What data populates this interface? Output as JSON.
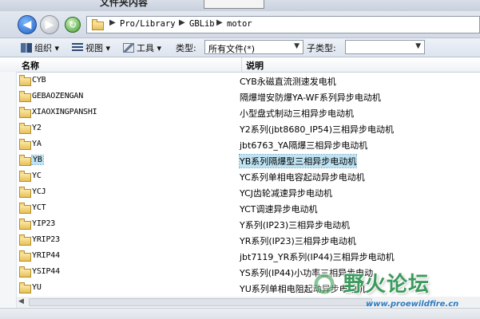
{
  "window": {
    "title": "文件夹内容"
  },
  "nav": {
    "back": "◀",
    "forward": "▶",
    "refresh": "↻",
    "path": [
      "Pro/Library",
      "GBLib",
      "motor"
    ],
    "sep": "▶"
  },
  "toolbar": {
    "organize": "组织 ▾",
    "view": "视图 ▾",
    "tools": "工具 ▾",
    "type_label": "类型:",
    "type_value": "所有文件(*)",
    "subtype_label": "子类型:",
    "subtype_value": ""
  },
  "columns": {
    "name": "名称",
    "desc": "说明"
  },
  "files": [
    {
      "name": "CYB",
      "desc": "CYB永磁直流测速发电机"
    },
    {
      "name": "GEBAOZENGAN",
      "desc": "隔爆增安防爆YA-WF系列异步电动机"
    },
    {
      "name": "XIAOXINGPANSHI",
      "desc": "小型盘式制动三相异步电动机"
    },
    {
      "name": "Y2",
      "desc": "Y2系列(jbt8680_IP54)三相异步电动机"
    },
    {
      "name": "YA",
      "desc": "jbt6763_YA隔爆三相异步电动机"
    },
    {
      "name": "YB",
      "desc": "YB系列隔爆型三相异步电动机"
    },
    {
      "name": "YC",
      "desc": "YC系列单相电容起动异步电动机"
    },
    {
      "name": "YCJ",
      "desc": "YCJ齿轮减速异步电动机"
    },
    {
      "name": "YCT",
      "desc": "YCT调速异步电动机"
    },
    {
      "name": "YIP23",
      "desc": "Y系列(IP23)三相异步电动机"
    },
    {
      "name": "YRIP23",
      "desc": "YR系列(IP23)三相异步电动机"
    },
    {
      "name": "YRIP44",
      "desc": "jbt7119_YR系列(IP44)三相异步电动机"
    },
    {
      "name": "YSIP44",
      "desc": "YS系列(IP44)小功率三相异步电动"
    },
    {
      "name": "YU",
      "desc": "YU系列单相电阻起动异步电动机"
    }
  ],
  "selected_index": 5,
  "watermark": {
    "text": "野火论坛",
    "url": "www.proewildfire.cn"
  },
  "colors": {
    "selection": "#bfe3f3",
    "folder": "#e7c15a",
    "accent": "#1f5fbf"
  }
}
